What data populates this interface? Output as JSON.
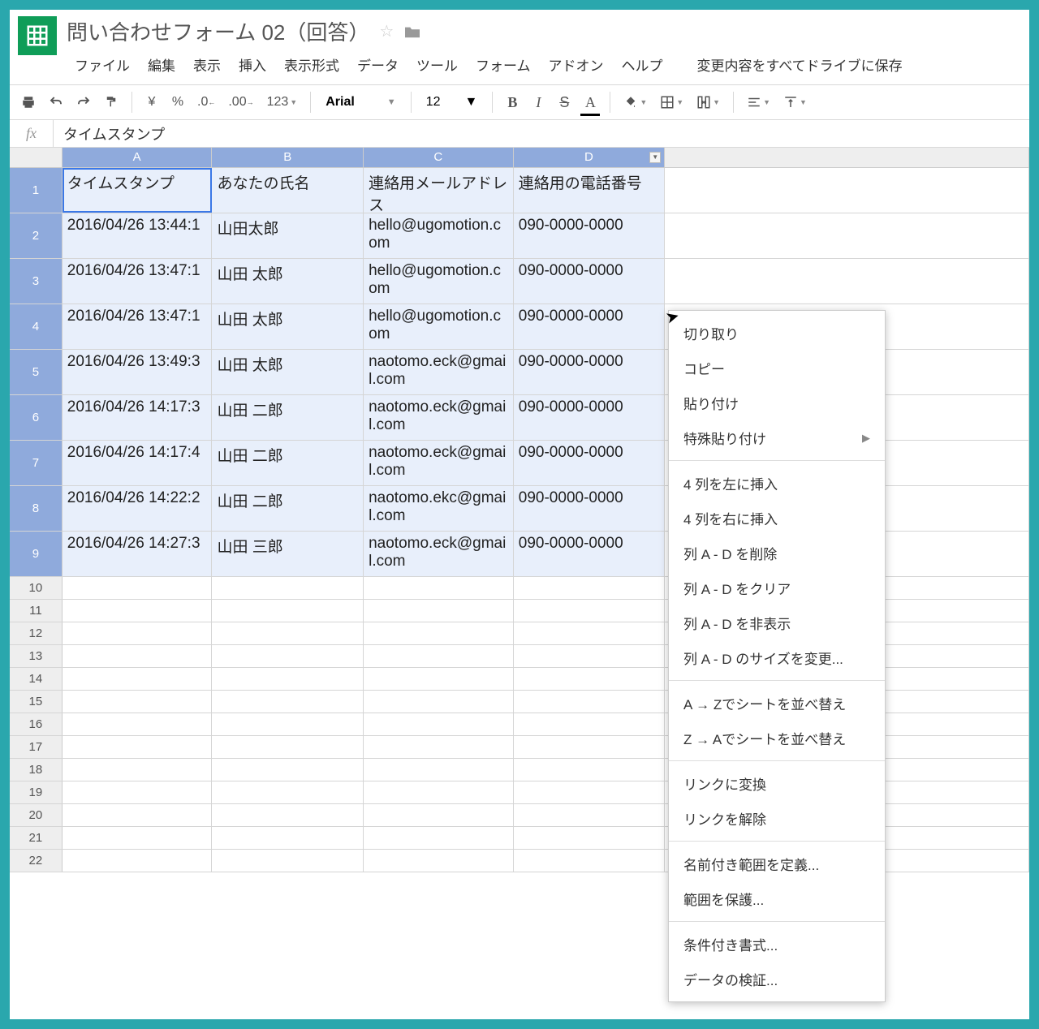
{
  "doc_title": "問い合わせフォーム 02（回答）",
  "save_status": "変更内容をすべてドライブに保存",
  "menu": [
    "ファイル",
    "編集",
    "表示",
    "挿入",
    "表示形式",
    "データ",
    "ツール",
    "フォーム",
    "アドオン",
    "ヘルプ"
  ],
  "toolbar": {
    "currency": "¥",
    "percent": "%",
    "dec_dec": ".0",
    "inc_dec": ".00",
    "more_fmt": "123",
    "font": "Arial",
    "size": "12",
    "bold": "B",
    "italic": "I",
    "strike": "S",
    "text_color": "A"
  },
  "formula": {
    "fx": "fx",
    "value": "タイムスタンプ"
  },
  "columns": [
    "A",
    "B",
    "C",
    "D"
  ],
  "selected_columns": [
    "A",
    "B",
    "C",
    "D"
  ],
  "headers": [
    "タイムスタンプ",
    "あなたの氏名",
    "連絡用メールアドレス",
    "連絡用の電話番号"
  ],
  "rows": [
    {
      "ts": "2016/04/26 13:44:1",
      "name": "山田太郎",
      "mail": "hello@ugomotion.com",
      "tel": "090-0000-0000"
    },
    {
      "ts": "2016/04/26 13:47:1",
      "name": "山田 太郎",
      "mail": "hello@ugomotion.com",
      "tel": "090-0000-0000"
    },
    {
      "ts": "2016/04/26 13:47:1",
      "name": "山田 太郎",
      "mail": "hello@ugomotion.com",
      "tel": "090-0000-0000"
    },
    {
      "ts": "2016/04/26 13:49:3",
      "name": "山田 太郎",
      "mail": "naotomo.eck@gmail.com",
      "tel": "090-0000-0000"
    },
    {
      "ts": "2016/04/26 14:17:3",
      "name": "山田 二郎",
      "mail": "naotomo.eck@gmail.com",
      "tel": "090-0000-0000"
    },
    {
      "ts": "2016/04/26 14:17:4",
      "name": "山田 二郎",
      "mail": "naotomo.eck@gmail.com",
      "tel": "090-0000-0000"
    },
    {
      "ts": "2016/04/26 14:22:2",
      "name": "山田 二郎",
      "mail": "naotomo.ekc@gmail.com",
      "tel": "090-0000-0000"
    },
    {
      "ts": "2016/04/26 14:27:3",
      "name": "山田 三郎",
      "mail": "naotomo.eck@gmail.com",
      "tel": "090-0000-0000"
    }
  ],
  "empty_rows": [
    10,
    11,
    12,
    13,
    14,
    15,
    16,
    17,
    18,
    19,
    20,
    21,
    22
  ],
  "context_menu": [
    {
      "type": "item",
      "label": "切り取り"
    },
    {
      "type": "item",
      "label": "コピー"
    },
    {
      "type": "item",
      "label": "貼り付け"
    },
    {
      "type": "item",
      "label": "特殊貼り付け",
      "sub": "▶"
    },
    {
      "type": "sep"
    },
    {
      "type": "item",
      "label": "4 列を左に挿入"
    },
    {
      "type": "item",
      "label": "4 列を右に挿入"
    },
    {
      "type": "item",
      "label": "列 A - D を削除"
    },
    {
      "type": "item",
      "label": "列 A - D をクリア"
    },
    {
      "type": "item",
      "label": "列 A - D を非表示"
    },
    {
      "type": "item",
      "label": "列 A - D のサイズを変更..."
    },
    {
      "type": "sep"
    },
    {
      "type": "item",
      "label": "A → Zでシートを並べ替え"
    },
    {
      "type": "item",
      "label": "Z → Aでシートを並べ替え"
    },
    {
      "type": "sep"
    },
    {
      "type": "item",
      "label": "リンクに変換"
    },
    {
      "type": "item",
      "label": "リンクを解除"
    },
    {
      "type": "sep"
    },
    {
      "type": "item",
      "label": "名前付き範囲を定義..."
    },
    {
      "type": "item",
      "label": "範囲を保護..."
    },
    {
      "type": "sep"
    },
    {
      "type": "item",
      "label": "条件付き書式..."
    },
    {
      "type": "item",
      "label": "データの検証..."
    }
  ],
  "row_labels": [
    "1",
    "2",
    "3",
    "4",
    "5",
    "6",
    "7",
    "8",
    "9"
  ]
}
